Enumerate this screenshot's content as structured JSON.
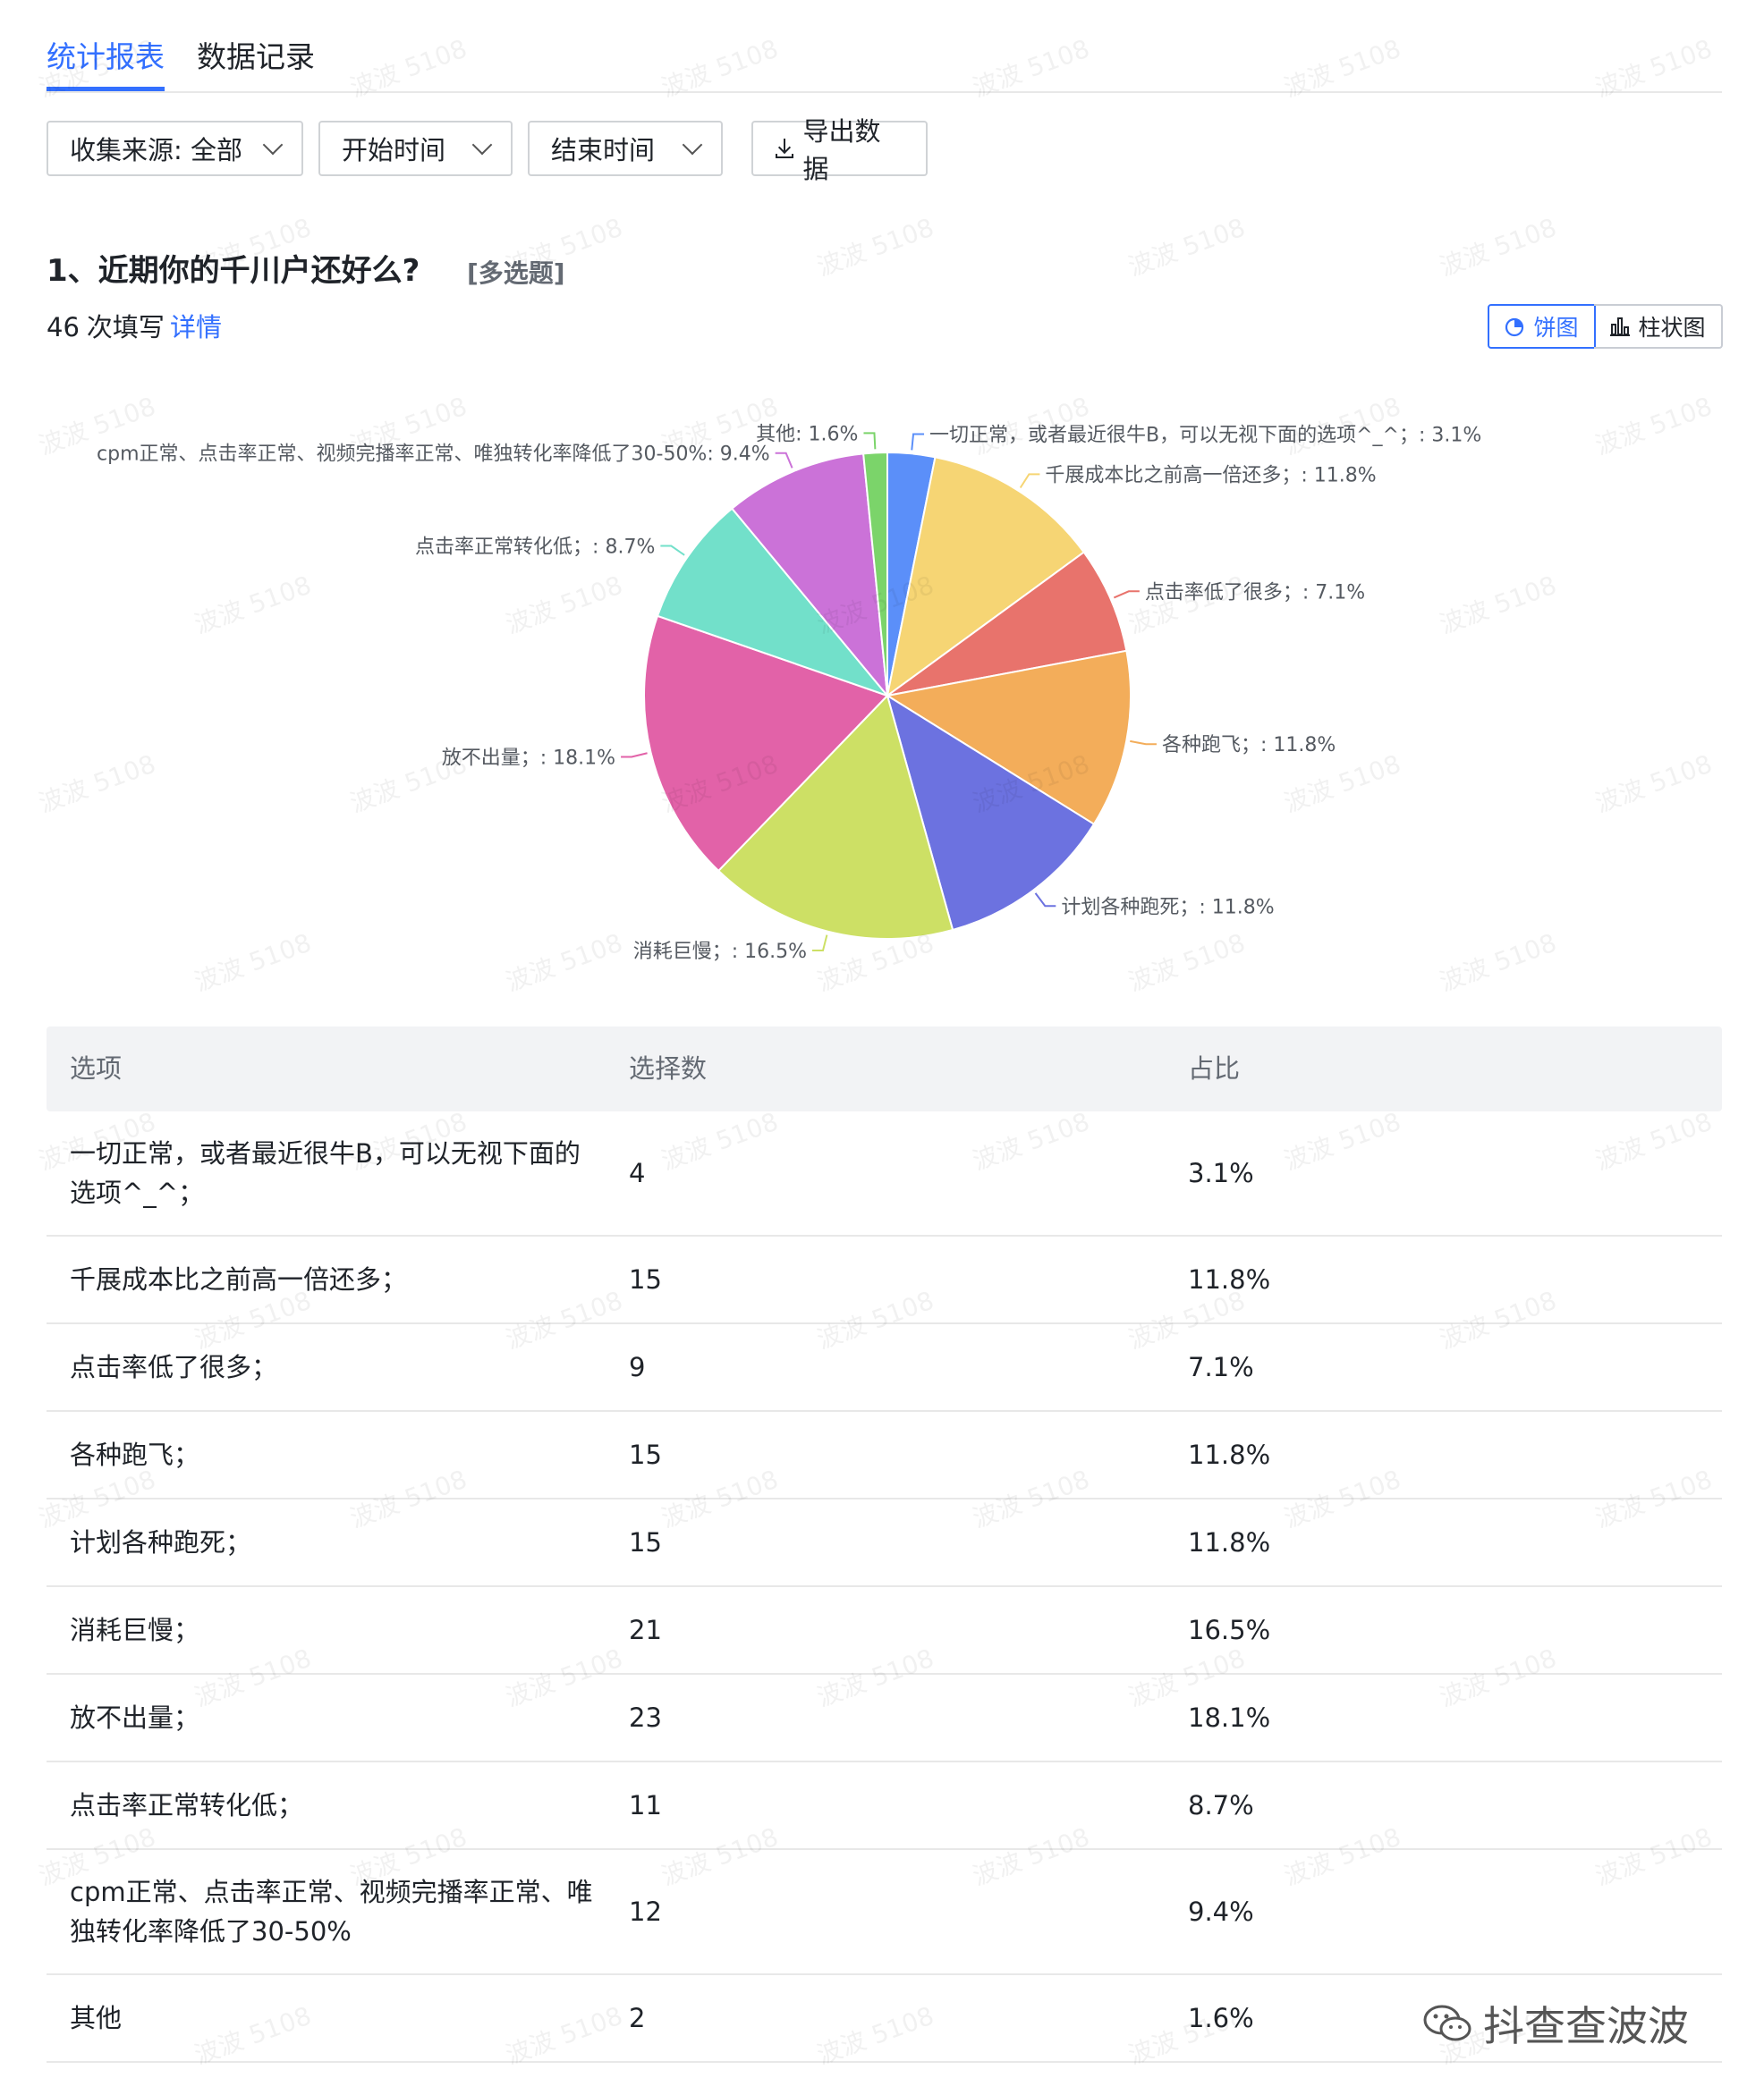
{
  "tabs": [
    "统计报表",
    "数据记录"
  ],
  "filters": {
    "source": "收集来源: 全部",
    "start": "开始时间",
    "end": "结束时间",
    "export": "导出数据"
  },
  "question": {
    "title": "1、近期你的千川户还好么?",
    "type": "[多选题]",
    "count": "46",
    "count_suffix": "次填写",
    "detail": "详情"
  },
  "view_toggle": {
    "pie": "饼图",
    "bar": "柱状图"
  },
  "table_headers": [
    "选项",
    "选择数",
    "占比"
  ],
  "rows": [
    {
      "option": "一切正常，或者最近很牛B，可以无视下面的选项^_^；",
      "count": "4",
      "pct": "3.1%"
    },
    {
      "option": "千展成本比之前高一倍还多；",
      "count": "15",
      "pct": "11.8%"
    },
    {
      "option": "点击率低了很多；",
      "count": "9",
      "pct": "7.1%"
    },
    {
      "option": "各种跑飞；",
      "count": "15",
      "pct": "11.8%"
    },
    {
      "option": "计划各种跑死；",
      "count": "15",
      "pct": "11.8%"
    },
    {
      "option": "消耗巨慢；",
      "count": "21",
      "pct": "16.5%"
    },
    {
      "option": "放不出量；",
      "count": "23",
      "pct": "18.1%"
    },
    {
      "option": "点击率正常转化低；",
      "count": "11",
      "pct": "8.7%"
    },
    {
      "option": "cpm正常、点击率正常、视频完播率正常、唯独转化率降低了30-50%",
      "count": "12",
      "pct": "9.4%"
    },
    {
      "option": "其他",
      "count": "2",
      "pct": "1.6%"
    }
  ],
  "chart_data": {
    "type": "pie",
    "categories": [
      "一切正常，或者最近很牛B，可以无视下面的选项^_^；",
      "千展成本比之前高一倍还多；",
      "点击率低了很多；",
      "各种跑飞；",
      "计划各种跑死；",
      "消耗巨慢；",
      "放不出量；",
      "点击率正常转化低；",
      "cpm正常、点击率正常、视频完播率正常、唯独转化率降低了30-50%",
      "其他"
    ],
    "values": [
      4,
      15,
      9,
      15,
      15,
      21,
      23,
      11,
      12,
      2
    ],
    "percents": [
      "3.1%",
      "11.8%",
      "7.1%",
      "11.8%",
      "11.8%",
      "16.5%",
      "18.1%",
      "8.7%",
      "9.4%",
      "1.6%"
    ],
    "labels": [
      "一切正常，或者最近很牛B，可以无视下面的选项^_^；: 3.1%",
      "千展成本比之前高一倍还多；: 11.8%",
      "点击率低了很多；: 7.1%",
      "各种跑飞；: 11.8%",
      "计划各种跑死；: 11.8%",
      "消耗巨慢；: 16.5%",
      "放不出量；: 18.1%",
      "点击率正常转化低；: 8.7%",
      "cpm正常、点击率正常、视频完播率正常、唯独转化率降低了30-50%: 9.4%",
      "其他: 1.6%"
    ],
    "colors": [
      "#5b8ff9",
      "#f6d574",
      "#e8736c",
      "#f3ad5a",
      "#6c72e0",
      "#cde065",
      "#e262a8",
      "#72e0ca",
      "#cb72d8",
      "#7bd46a"
    ]
  },
  "watermark": "波波 5108",
  "brand": "抖查查波波"
}
